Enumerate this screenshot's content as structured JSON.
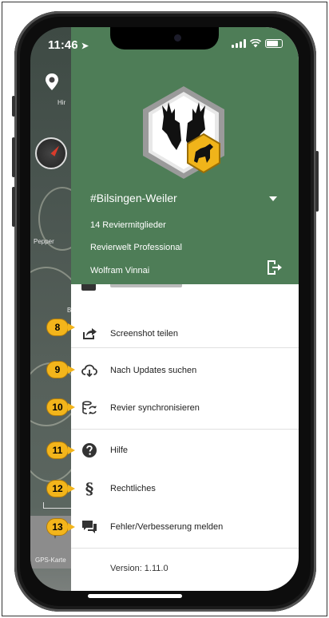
{
  "status_bar": {
    "time": "11:46"
  },
  "map": {
    "labels": [
      "Hir",
      "Pepper",
      "B"
    ],
    "gps_label": "GPS-Karte"
  },
  "drawer": {
    "header_color": "#4e7d57",
    "revier_name": "#Bilsingen-Weiler",
    "members": "14 Reviermitglieder",
    "plan": "Revierwelt Professional",
    "user": "Wolfram Vinnai"
  },
  "menu": {
    "items": [
      {
        "label": "Screenshot teilen",
        "icon": "share-icon",
        "badge": "8"
      },
      {
        "label": "Nach Updates suchen",
        "icon": "cloud-download-icon",
        "badge": "9"
      },
      {
        "label": "Revier synchronisieren",
        "icon": "sync-icon",
        "badge": "10"
      },
      {
        "label": "Hilfe",
        "icon": "help-icon",
        "badge": "11"
      },
      {
        "label": "Rechtliches",
        "icon": "paragraph-icon",
        "badge": "12"
      },
      {
        "label": "Fehler/Verbesserung melden",
        "icon": "feedback-icon",
        "badge": "13"
      }
    ],
    "version": "Version: 1.11.0"
  },
  "colors": {
    "accent_badge": "#f3b51b",
    "header": "#4e7d57"
  }
}
